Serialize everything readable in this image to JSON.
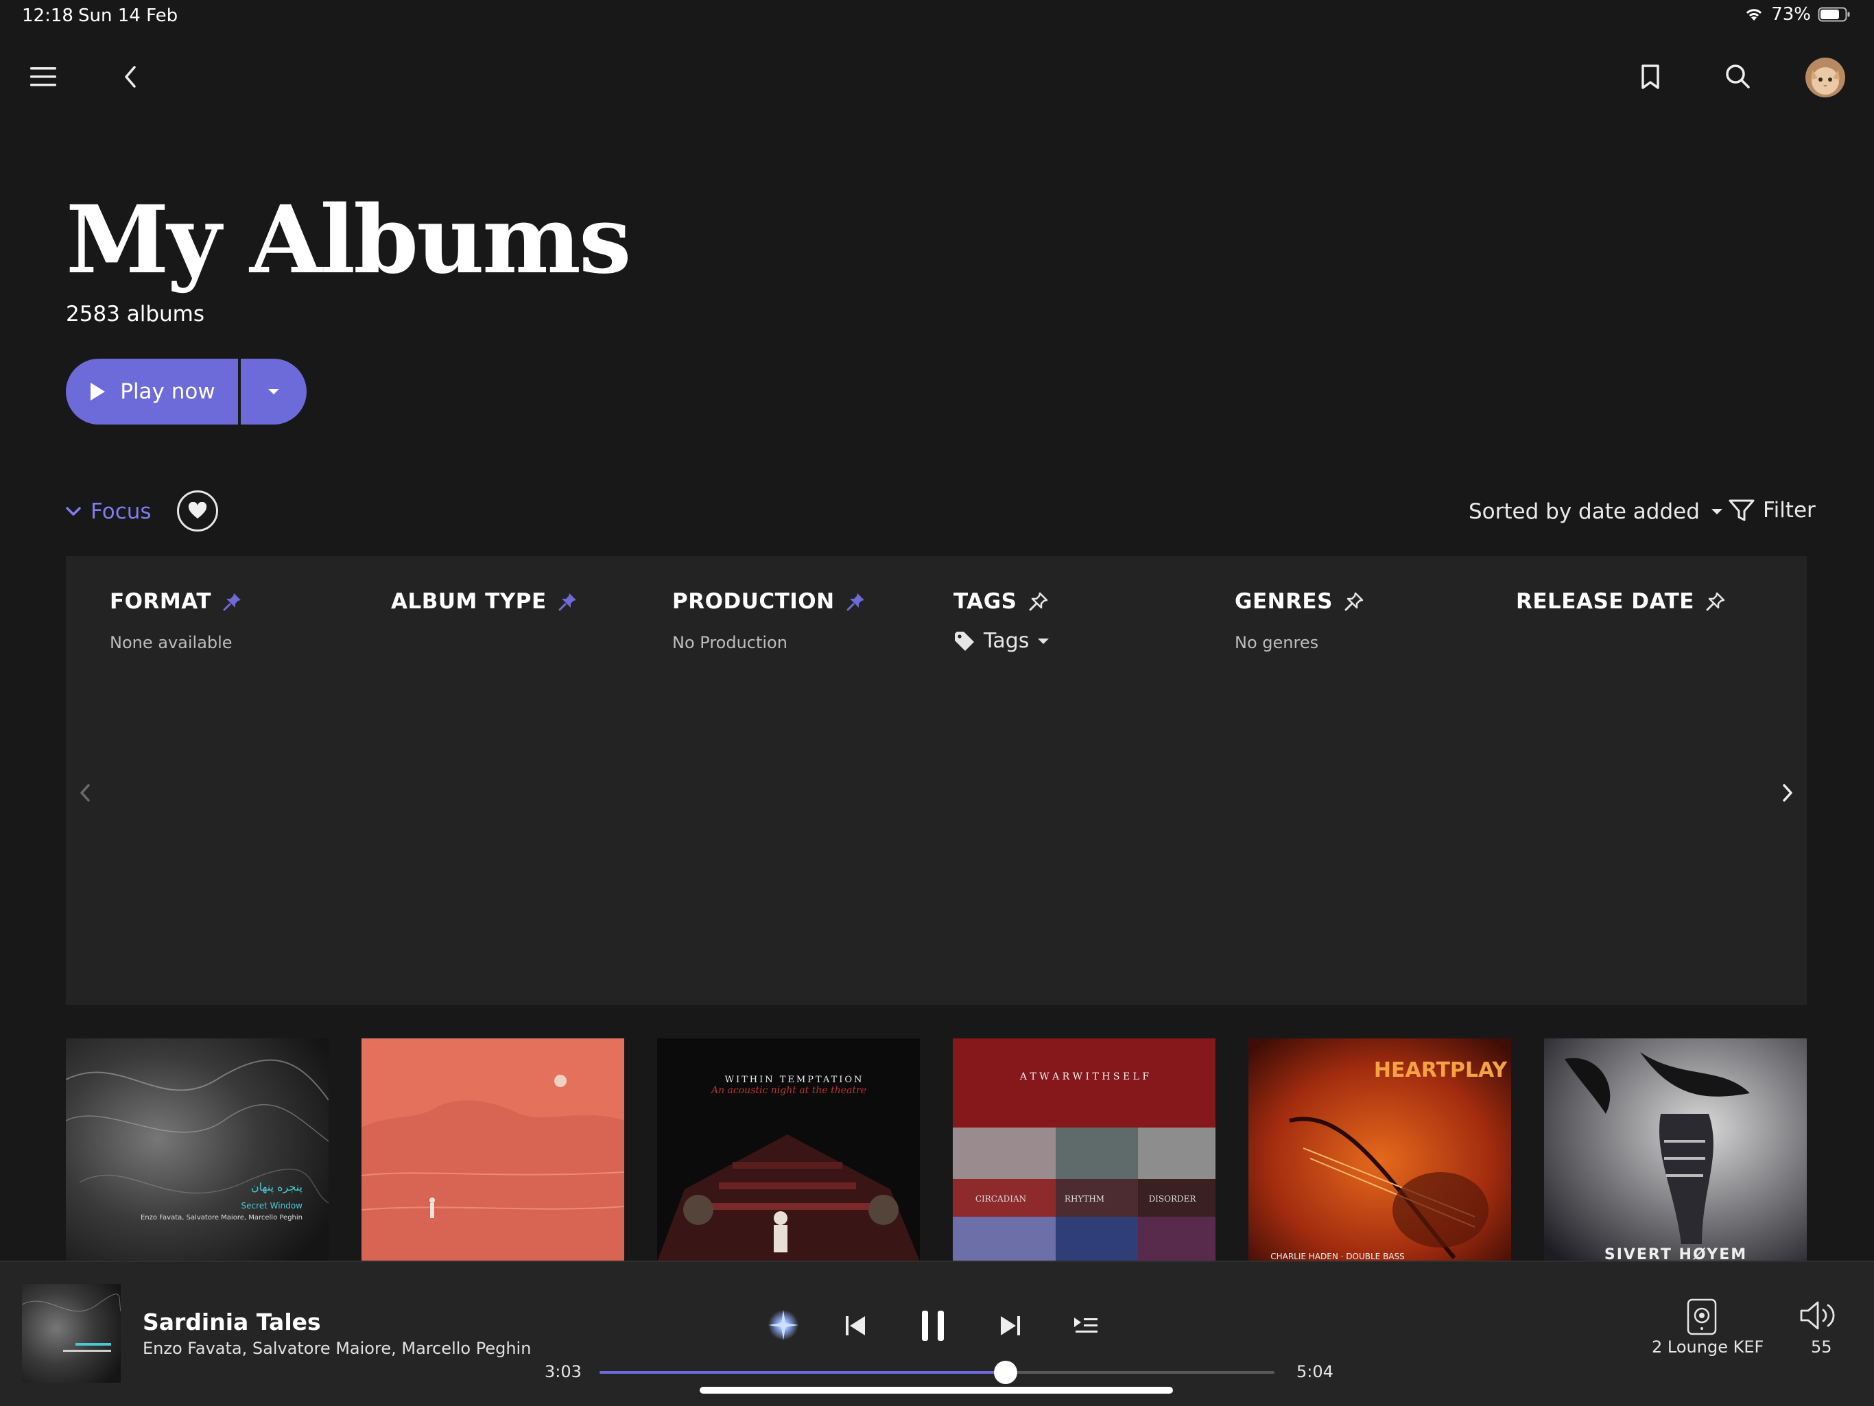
{
  "status_bar": {
    "time": "12:18",
    "date": "Sun 14 Feb",
    "battery": "73%"
  },
  "header": {
    "title": "My Albums",
    "album_count": "2583 albums"
  },
  "actions": {
    "play_now_label": "Play now"
  },
  "focus": {
    "label": "Focus",
    "sort_label": "Sorted by date added",
    "filter_label": "Filter",
    "facets": [
      {
        "title": "FORMAT",
        "value": "None available"
      },
      {
        "title": "ALBUM TYPE",
        "value": ""
      },
      {
        "title": "PRODUCTION",
        "value": "No Production"
      },
      {
        "title": "TAGS",
        "value": "Tags"
      },
      {
        "title": "GENRES",
        "value": "No genres"
      },
      {
        "title": "RELEASE DATE",
        "value": ""
      }
    ]
  },
  "albums": [
    {
      "cover_text_1": "پنجره پنهان",
      "cover_text_2": "Secret Window",
      "cover_text_3": "Enzo Favata, Salvatore Maiore, Marcello Peghin"
    },
    {
      "cover_text_1": ""
    },
    {
      "cover_text_1": "WITHIN TEMPTATION",
      "cover_text_2": "An acoustic night at the theatre"
    },
    {
      "cover_text_1": "A T   W A R   W I T H   S E L F",
      "cover_text_2": "CIRCADIAN",
      "cover_text_3": "RHYTHM",
      "cover_text_4": "DISORDER"
    },
    {
      "cover_text_1": "HEARTPLAY",
      "cover_text_2": "CHARLIE HADEN · DOUBLE BASS"
    },
    {
      "cover_text_1": "SIVERT HØYEM"
    }
  ],
  "player": {
    "track_title": "Sardinia Tales",
    "track_artists": "Enzo Favata, Salvatore Maiore, Marcello Peghin",
    "elapsed": "3:03",
    "total": "5:04",
    "progress": 0.602,
    "zone": "2 Lounge KEF",
    "volume": "55"
  },
  "colors": {
    "accent": "#6d6ad9",
    "background": "#181818",
    "panel": "#232323",
    "player_bar": "#252525"
  }
}
